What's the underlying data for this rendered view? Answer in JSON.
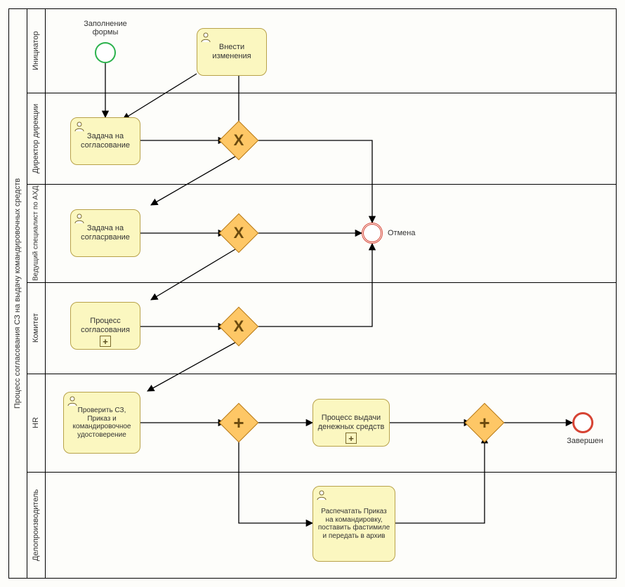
{
  "pool": {
    "title": "Процесс согласования СЗ на выдачу командировочных средств"
  },
  "lanes": {
    "l1": "Инициатор",
    "l2": "Директор дирекции",
    "l3": "Ведущий специалист по АХД",
    "l4": "Комитет",
    "l5": "HR",
    "l6": "Делопроизводитель"
  },
  "events": {
    "start_label": "Заполнение формы",
    "cancel_label": "Отмена",
    "end_label": "Завершен"
  },
  "tasks": {
    "t1": "Внести изменения",
    "t2": "Задача на согласование",
    "t3": "Задача на согласрвание",
    "t4": "Процесс согласования",
    "t5": "Проверить СЗ, Приказ и командировочное удостоверение",
    "t6": "Процесс выдачи денежных средств",
    "t7": "Распечатать Приказ на командировку, поставить фастимиле и передать в архив"
  },
  "gateways": {
    "g1": "X",
    "g2": "X",
    "g3": "X",
    "g4": "+",
    "g5": "+"
  },
  "chart_data": {
    "type": "table",
    "description": "BPMN swimlane diagram",
    "pool": "Процесс согласования СЗ на выдачу командировочных средств",
    "lanes": [
      "Инициатор",
      "Директор дирекции",
      "Ведущий специалист по АХД",
      "Комитет",
      "HR",
      "Делопроизводитель"
    ],
    "nodes": [
      {
        "id": "start",
        "type": "startEvent",
        "lane": "Инициатор",
        "label": "Заполнение формы"
      },
      {
        "id": "t1",
        "type": "userTask",
        "lane": "Инициатор",
        "label": "Внести изменения"
      },
      {
        "id": "t2",
        "type": "userTask",
        "lane": "Директор дирекции",
        "label": "Задача на согласование"
      },
      {
        "id": "g1",
        "type": "exclusiveGateway",
        "lane": "Директор дирекции"
      },
      {
        "id": "t3",
        "type": "userTask",
        "lane": "Ведущий специалист по АХД",
        "label": "Задача на согласрвание"
      },
      {
        "id": "g2",
        "type": "exclusiveGateway",
        "lane": "Ведущий специалист по АХД"
      },
      {
        "id": "cancel",
        "type": "terminateEvent",
        "lane": "Ведущий специалист по АХД",
        "label": "Отмена"
      },
      {
        "id": "t4",
        "type": "subProcess",
        "lane": "Комитет",
        "label": "Процесс согласования"
      },
      {
        "id": "g3",
        "type": "exclusiveGateway",
        "lane": "Комитет"
      },
      {
        "id": "t5",
        "type": "userTask",
        "lane": "HR",
        "label": "Проверить СЗ, Приказ и командировочное удостоверение"
      },
      {
        "id": "g4",
        "type": "parallelGateway",
        "lane": "HR"
      },
      {
        "id": "t6",
        "type": "subProcess",
        "lane": "HR",
        "label": "Процесс выдачи денежных средств"
      },
      {
        "id": "g5",
        "type": "parallelGateway",
        "lane": "HR"
      },
      {
        "id": "end",
        "type": "endEvent",
        "lane": "HR",
        "label": "Завершен"
      },
      {
        "id": "t7",
        "type": "userTask",
        "lane": "Делопроизводитель",
        "label": "Распечатать Приказ на командировку, поставить фастимиле и передать в архив"
      }
    ],
    "flows": [
      [
        "start",
        "t2"
      ],
      [
        "t2",
        "g1"
      ],
      [
        "g1",
        "t1"
      ],
      [
        "t1",
        "t2"
      ],
      [
        "g1",
        "cancel"
      ],
      [
        "g1",
        "t3"
      ],
      [
        "t3",
        "g2"
      ],
      [
        "g2",
        "cancel"
      ],
      [
        "g2",
        "t4"
      ],
      [
        "t4",
        "g3"
      ],
      [
        "g3",
        "cancel"
      ],
      [
        "g3",
        "t5"
      ],
      [
        "t5",
        "g4"
      ],
      [
        "g4",
        "t6"
      ],
      [
        "g4",
        "t7"
      ],
      [
        "t6",
        "g5"
      ],
      [
        "t7",
        "g5"
      ],
      [
        "g5",
        "end"
      ]
    ]
  }
}
